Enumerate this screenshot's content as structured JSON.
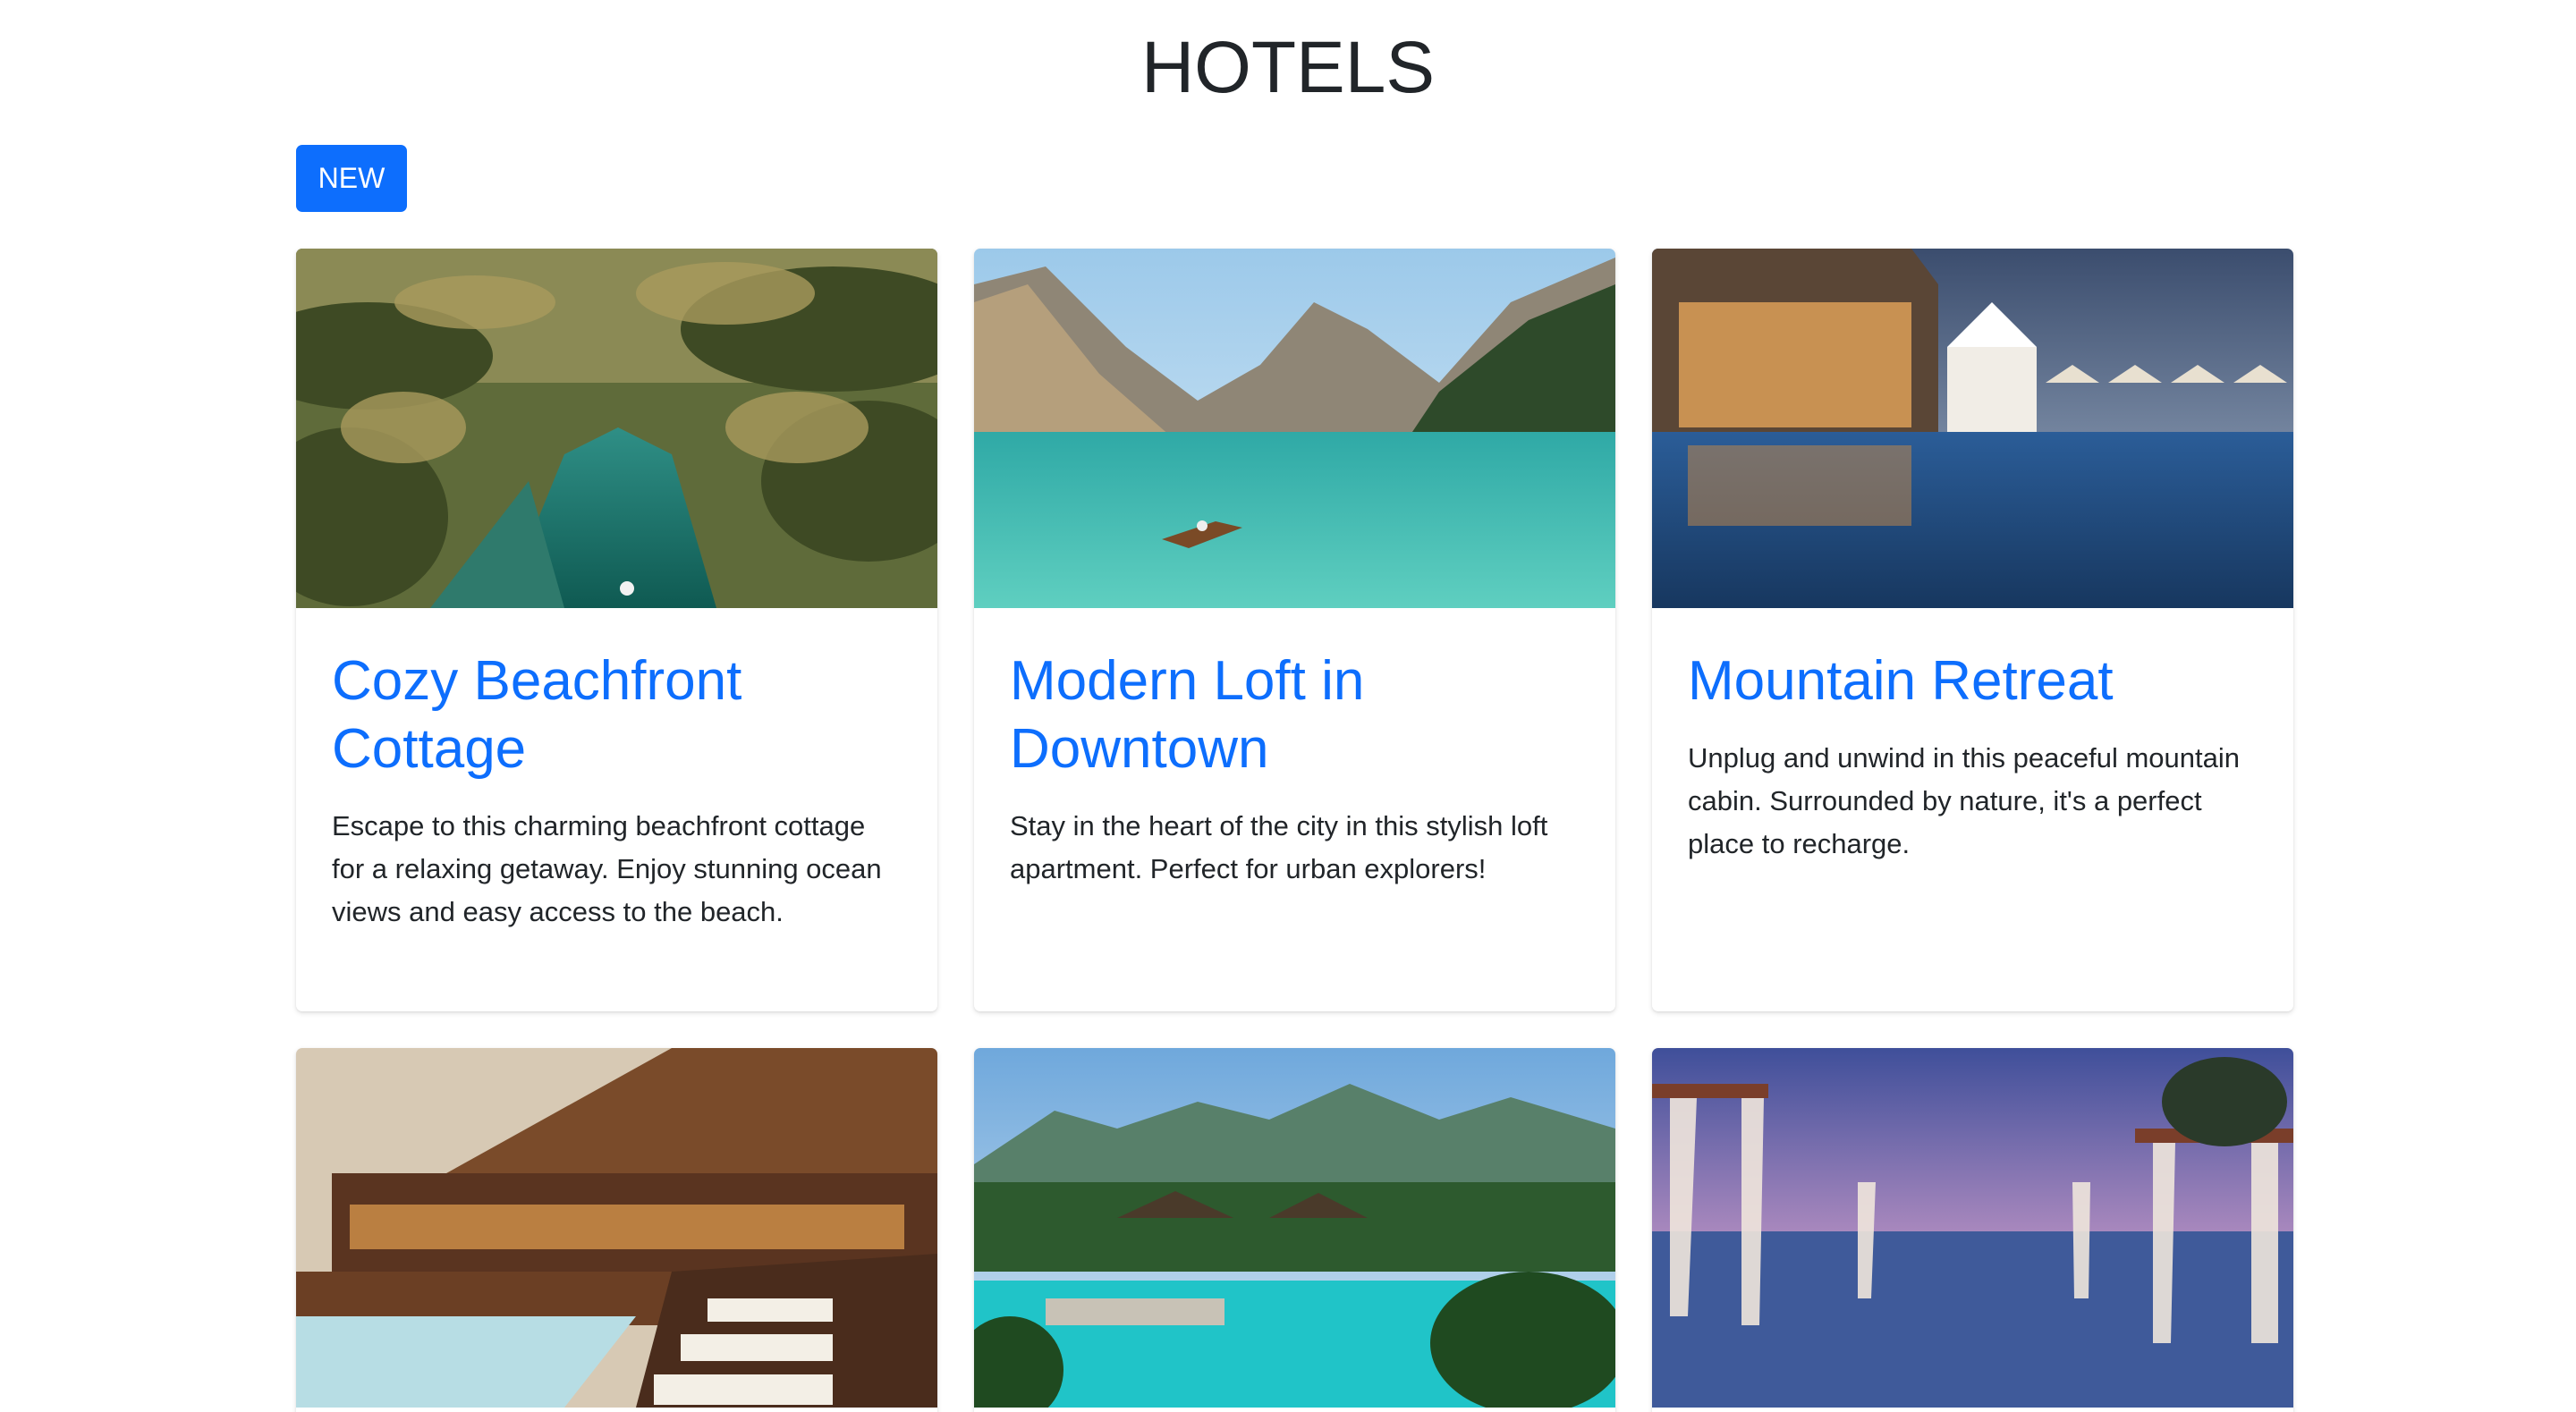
{
  "page": {
    "title": "HOTELS",
    "new_button_label": "NEW"
  },
  "theme": {
    "accent": "#0d6efd",
    "text": "#212529",
    "background": "#ffffff"
  },
  "hotels": [
    {
      "name": "Cozy Beachfront Cottage",
      "description": "Escape to this charming beachfront cottage for a relaxing getaway. Enjoy stunning ocean views and easy access to the beach.",
      "image": "tropical-lagoon-with-palm-trees"
    },
    {
      "name": "Modern Loft in Downtown",
      "description": "Stay in the heart of the city in this stylish loft apartment. Perfect for urban explorers!",
      "image": "mountain-lake-with-rowboat"
    },
    {
      "name": "Mountain Retreat",
      "description": "Unplug and unwind in this peaceful mountain cabin. Surrounded by nature, it's a perfect place to recharge.",
      "image": "resort-pool-at-dusk"
    },
    {
      "name": "",
      "description": "",
      "image": "wooden-lodge-with-infinity-pool"
    },
    {
      "name": "",
      "description": "",
      "image": "tropical-resort-pool-with-huts"
    },
    {
      "name": "",
      "description": "",
      "image": "cabanas-by-ocean-at-sunset"
    }
  ]
}
